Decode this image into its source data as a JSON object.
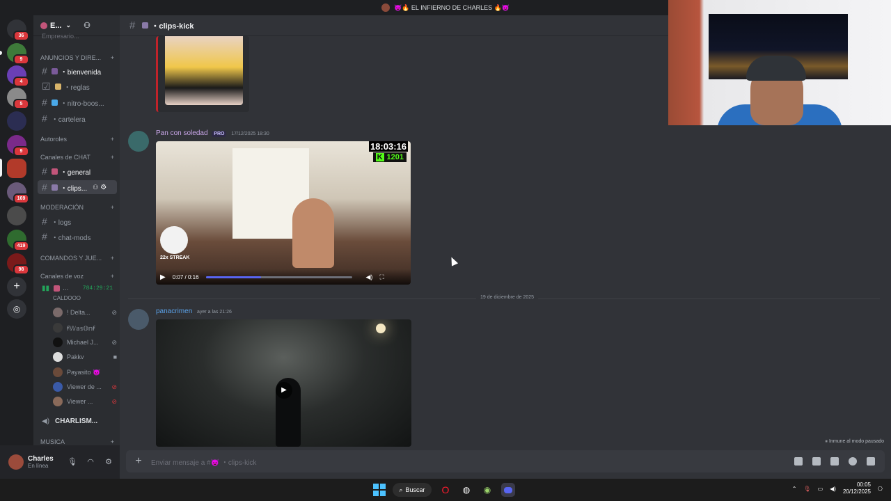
{
  "window": {
    "title": "👿🔥 EL INFIERNO DE CHARLES 🔥👿"
  },
  "servers": [
    {
      "badge": "36"
    },
    {
      "badge": "9"
    },
    {
      "badge": "4"
    },
    {
      "badge": "5"
    },
    {
      "badge": ""
    },
    {
      "badge": "9"
    },
    {
      "badge": ""
    },
    {
      "badge": "169"
    },
    {
      "badge": ""
    },
    {
      "badge": "419"
    },
    {
      "badge": "98"
    }
  ],
  "sidebar": {
    "guild_name": "E...",
    "partial_item": "Empresario...",
    "categories": {
      "announcements": "ANUNCIOS Y DIRE...",
      "autoroles": "Autoroles",
      "chat": "Canales de CHAT",
      "moderation": "MODERACIÓN",
      "commands": "COMANDOS Y JUE...",
      "voice": "Canales de voz",
      "music": "MUSICA"
    },
    "channels": {
      "bienvenida": "・bienvenida",
      "reglas": "・reglas",
      "nitro": "・nitro-boos...",
      "cartelera": "・cartelera",
      "general": "・general",
      "clips": "・clips...",
      "logs": "・logs",
      "chatmods": "・chat-mods"
    },
    "voice_channel": {
      "name": "...",
      "timer": "784:29:21",
      "sub": "CALDOOO",
      "users": [
        "! Delta...",
        "ꞙ𝕎𝕒𝕤𝕆𝕟ꞙ",
        "Michael J...",
        "Pakkv",
        "Payasito 👿",
        "Viewer de ...",
        "Viewer ..."
      ]
    },
    "stage_channel": "CHARLISM..."
  },
  "user_panel": {
    "name": "Charles",
    "status": "En línea"
  },
  "channel_header": {
    "name": "・clips-kick"
  },
  "messages": [
    {
      "author": "Pan con soledad",
      "badge": "PRO",
      "time": "17/12/2025 18:30",
      "author_color": "#c9a6e8",
      "video": {
        "overlay_clock": "18:03:16",
        "overlay_count": "1201",
        "streak": "22x STREAK",
        "time": "0:07 / 0:16",
        "progress": 0.38
      }
    },
    {
      "author": "panacrimen",
      "time": "ayer a las 21:26",
      "author_color": "#5aa0e6"
    }
  ],
  "date_divider": "19 de diciembre de 2025",
  "composer": {
    "placeholder": "Enviar mensaje a #👿 ・clips-kick"
  },
  "status_note": "Inmune al modo pausado",
  "taskbar": {
    "search": "Buscar",
    "time": "00:05",
    "date": "20/12/2025"
  }
}
